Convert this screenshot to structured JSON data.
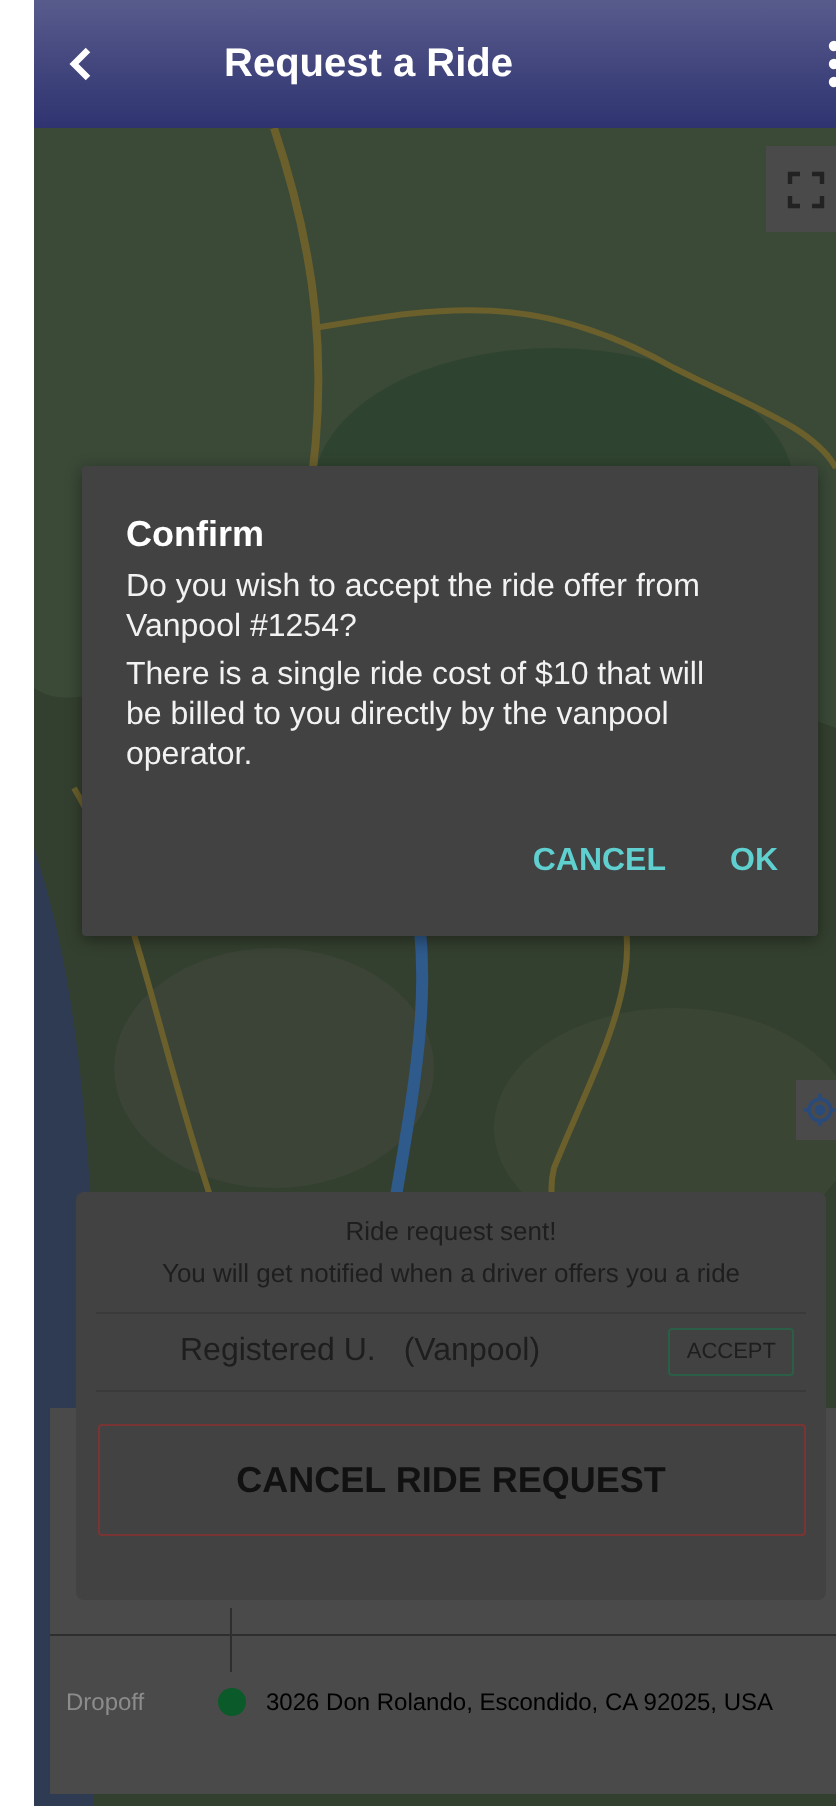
{
  "header": {
    "title": "Request a Ride"
  },
  "dialog": {
    "title": "Confirm",
    "paragraphs": [
      "Do you wish to accept the ride offer from Vanpool #1254?",
      "There is a single ride cost of $10 that will be billed to you directly by the vanpool operator."
    ],
    "buttons": [
      "CANCEL",
      "OK"
    ]
  },
  "request_panel": {
    "status": "Ride request sent!",
    "note": "You will get notified when a driver offers you a ride",
    "offer": {
      "name": "Registered U.",
      "type": "(Vanpool)",
      "action": "ACCEPT"
    },
    "cancel_button": "CANCEL RIDE REQUEST"
  },
  "route": {
    "label": "Dropoff",
    "address": "3026 Don Rolando, Escondido, CA 92025, USA"
  }
}
